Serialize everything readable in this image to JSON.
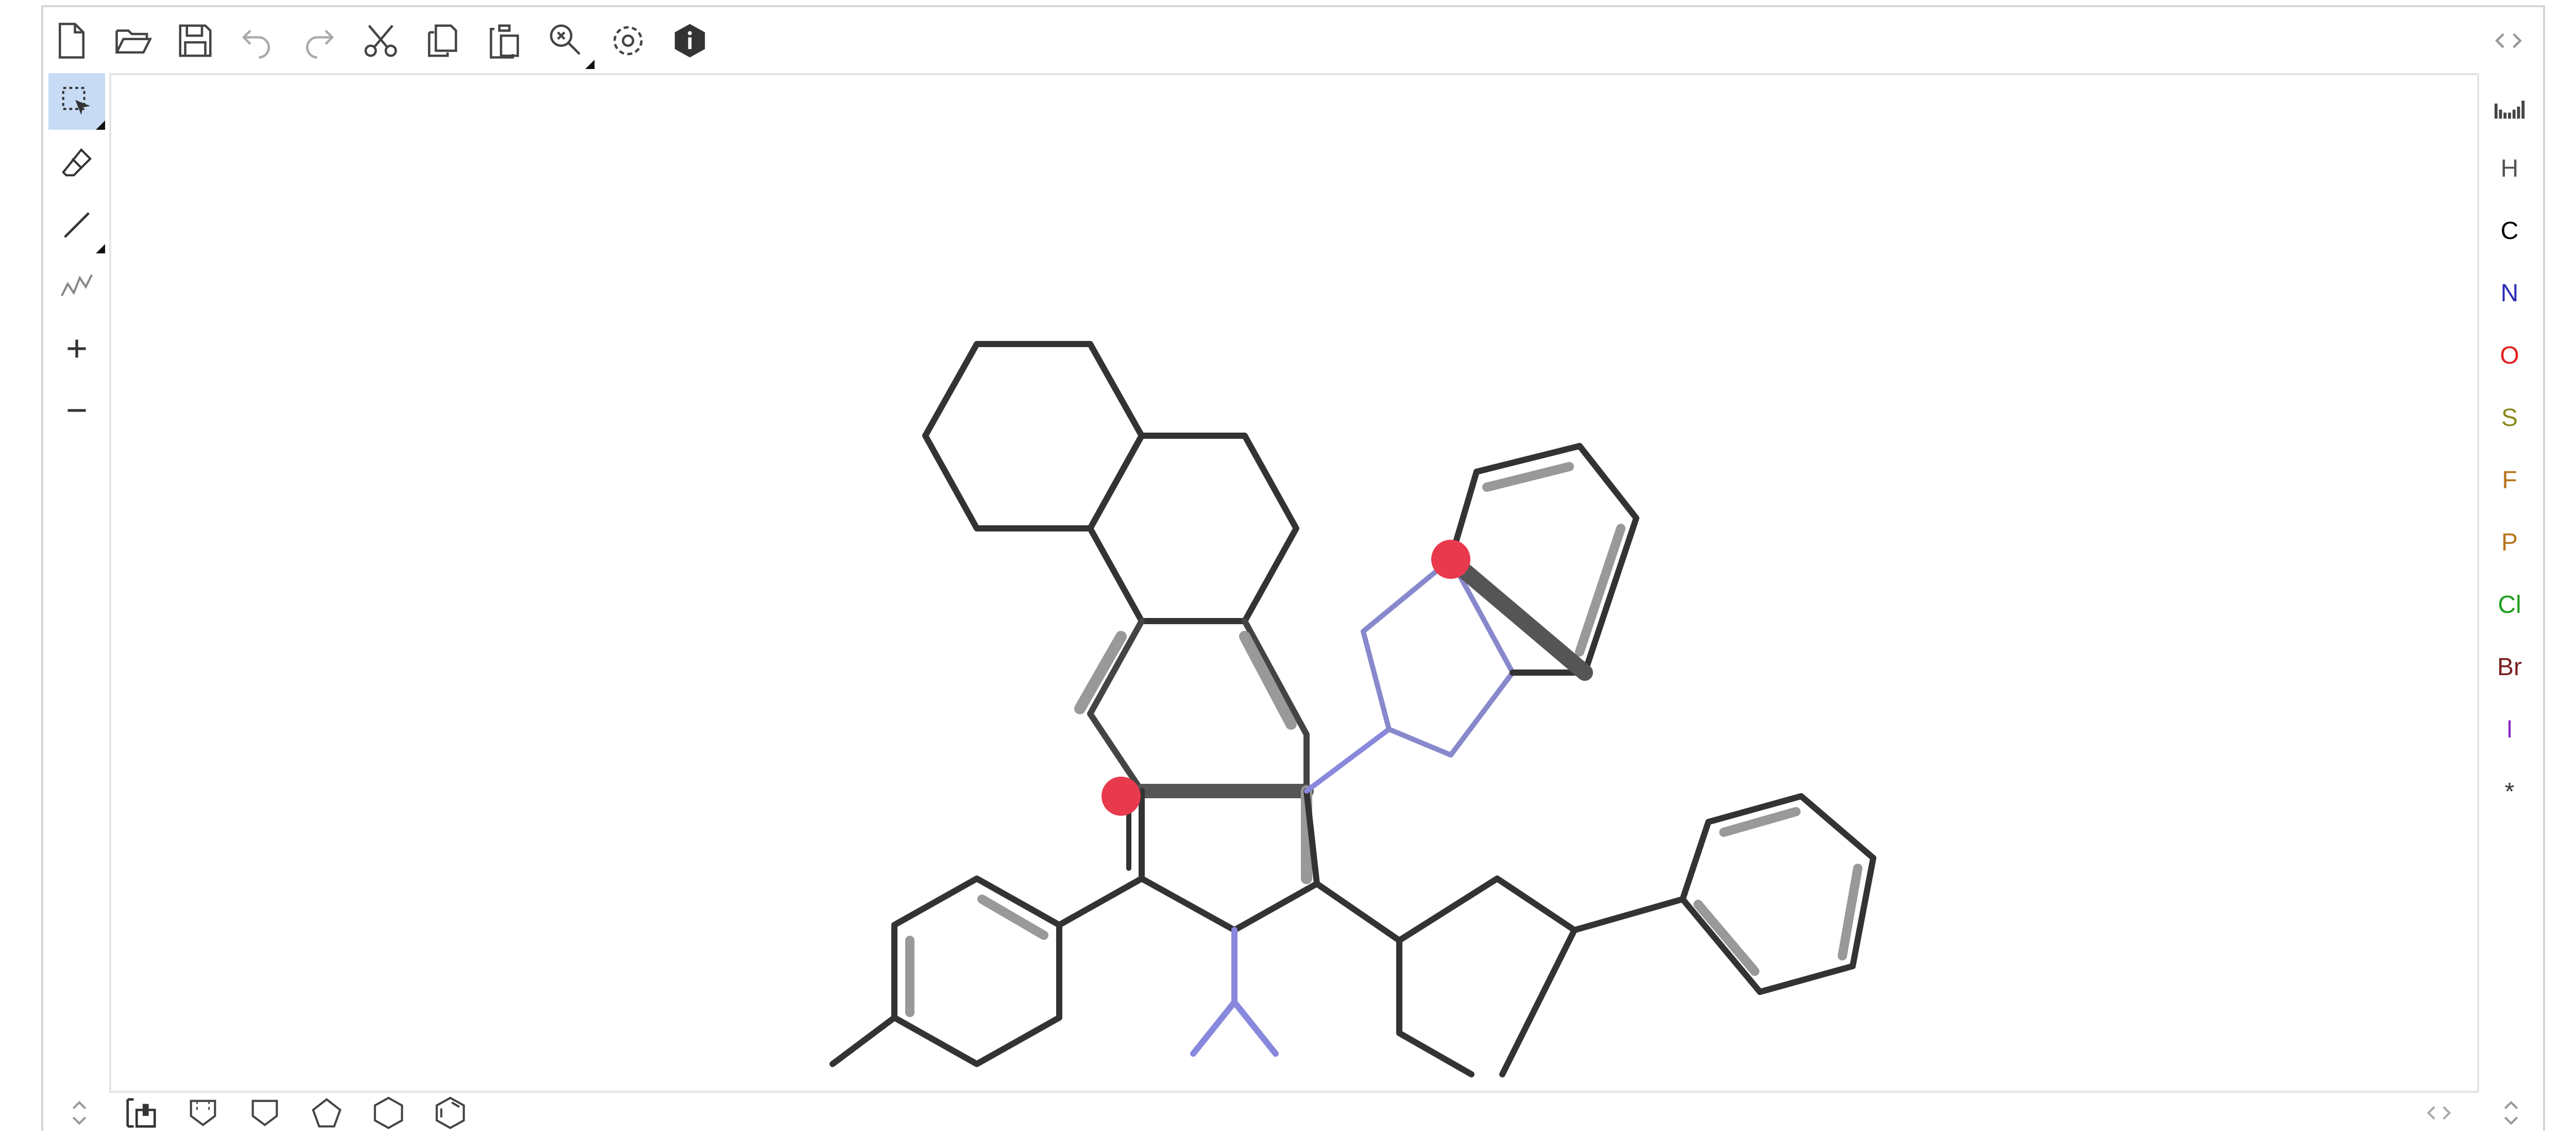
{
  "toolbar": {
    "top": [
      {
        "name": "new-document-icon"
      },
      {
        "name": "open-folder-icon"
      },
      {
        "name": "save-icon"
      },
      {
        "name": "undo-icon"
      },
      {
        "name": "redo-icon"
      },
      {
        "name": "cut-icon"
      },
      {
        "name": "copy-icon"
      },
      {
        "name": "paste-icon"
      },
      {
        "name": "zoom-menu-icon"
      },
      {
        "name": "settings-gear-icon"
      },
      {
        "name": "info-icon"
      }
    ],
    "left": [
      {
        "name": "select-lasso-icon",
        "active": true
      },
      {
        "name": "eraser-icon"
      },
      {
        "name": "single-bond-icon"
      },
      {
        "name": "chain-icon"
      },
      {
        "name": "charge-plus-icon"
      },
      {
        "name": "charge-minus-icon"
      }
    ],
    "bottom": [
      {
        "name": "template-icon"
      },
      {
        "name": "cyclopropane-icon"
      },
      {
        "name": "cyclobutane-icon"
      },
      {
        "name": "cyclopentane-icon"
      },
      {
        "name": "cyclohexane-icon"
      },
      {
        "name": "benzene-icon"
      }
    ]
  },
  "atoms": [
    {
      "symbol": "H",
      "color": "#555555"
    },
    {
      "symbol": "C",
      "color": "#000000"
    },
    {
      "symbol": "N",
      "color": "#2c2cb5"
    },
    {
      "symbol": "O",
      "color": "#e01f1f"
    },
    {
      "symbol": "S",
      "color": "#8a8a1e"
    },
    {
      "symbol": "F",
      "color": "#b8741a"
    },
    {
      "symbol": "P",
      "color": "#b8741a"
    },
    {
      "symbol": "Cl",
      "color": "#1e9e1e"
    },
    {
      "symbol": "Br",
      "color": "#7a1f1f"
    },
    {
      "symbol": "I",
      "color": "#8b2bc2"
    },
    {
      "symbol": "*",
      "color": "#333333"
    }
  ],
  "periodic_table_icon": "periodic-table-icon",
  "colors": {
    "accent": "#c7dbf5",
    "bond": "#222222",
    "nitrogen_bond": "#6a6ad0",
    "highlight_atom": "#e8394d"
  }
}
